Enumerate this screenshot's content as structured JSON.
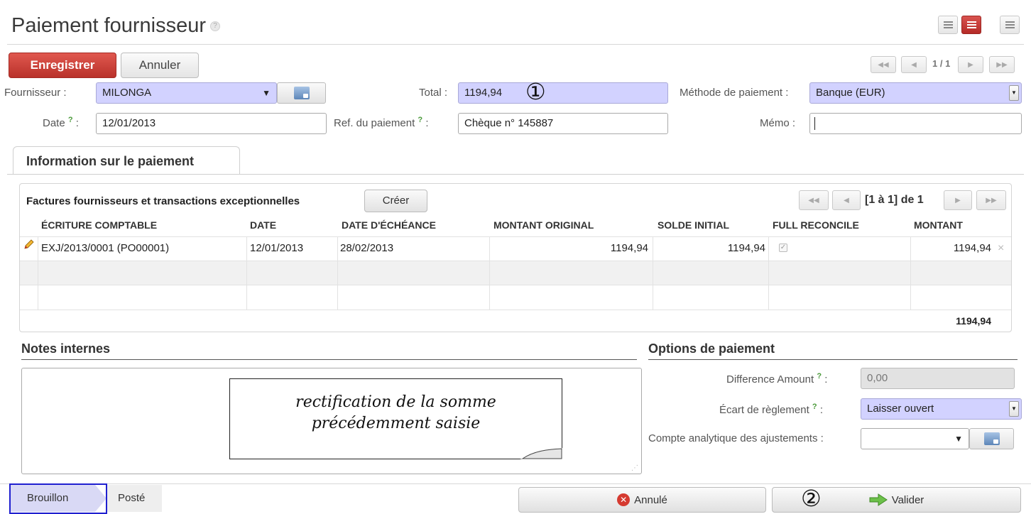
{
  "header": {
    "title": "Paiement fournisseur",
    "help": "?"
  },
  "toolbar": {
    "save_label": "Enregistrer",
    "cancel_label": "Annuler",
    "pager": "1 / 1"
  },
  "form": {
    "supplier_label": "Fournisseur :",
    "supplier_value": "MILONGA",
    "total_label": "Total :",
    "total_value": "1194,94",
    "payment_method_label": "Méthode de paiement :",
    "payment_method_value": "Banque (EUR)",
    "date_label": "Date",
    "date_value": "12/01/2013",
    "payment_ref_label": "Ref. du paiement",
    "payment_ref_value": "Chèque n° 145887",
    "memo_label": "Mémo :",
    "memo_value": "",
    "help_mark": "?",
    "colon": ":"
  },
  "annotations": {
    "marker_1": "①",
    "marker_2": "②"
  },
  "tabs": [
    {
      "label": "Information sur le paiement"
    }
  ],
  "grid": {
    "title": "Factures fournisseurs et transactions exceptionnelles",
    "create_label": "Créer",
    "pager": "[1 à 1] de 1",
    "columns": [
      "ÉCRITURE COMPTABLE",
      "DATE",
      "DATE D'ÉCHÉANCE",
      "MONTANT ORIGINAL",
      "SOLDE INITIAL",
      "FULL RECONCILE",
      "MONTANT"
    ],
    "rows": [
      {
        "entry": "EXJ/2013/0001 (PO00001)",
        "date": "12/01/2013",
        "due_date": "28/02/2013",
        "original_amount": "1194,94",
        "initial_balance": "1194,94",
        "full_reconcile": true,
        "amount": "1194,94"
      }
    ],
    "total": "1194,94"
  },
  "notes": {
    "heading": "Notes internes",
    "callout_line1": "rectification de la somme",
    "callout_line2": "précédemment saisie"
  },
  "options": {
    "heading": "Options de paiement",
    "difference_label": "Difference Amount",
    "difference_value": "0,00",
    "writeoff_label": "Écart de règlement",
    "writeoff_value": "Laisser ouvert",
    "analytic_label": "Compte analytique des ajustements :",
    "analytic_value": ""
  },
  "statusbar": {
    "stages": [
      "Brouillon",
      "Posté"
    ],
    "active_stage": "Brouillon",
    "cancel_label": "Annulé",
    "validate_label": "Valider"
  },
  "colors": {
    "accent_red": "#c9302c",
    "required_field": "#d2d2ff",
    "active_stage": "#d9d9f5"
  }
}
